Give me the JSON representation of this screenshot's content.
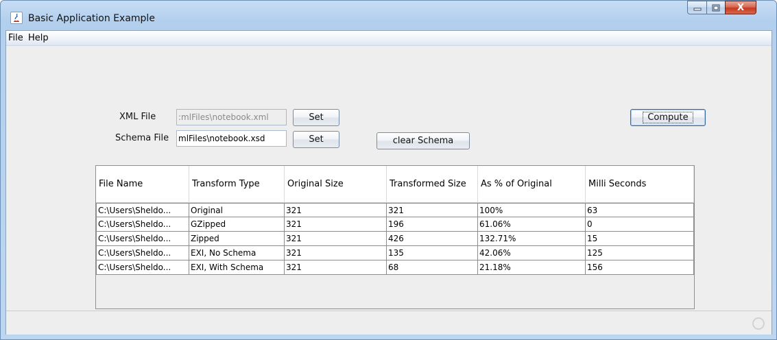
{
  "window": {
    "title": "Basic Application Example",
    "controls": {
      "minimize": "minimize",
      "maximize": "maximize",
      "close": "X"
    }
  },
  "menu": {
    "items": [
      "File",
      "Help"
    ]
  },
  "form": {
    "xml_label": "XML File",
    "xml_value": ":mlFiles\\notebook.xml",
    "schema_label": "Schema File",
    "schema_value": "mlFiles\\notebook.xsd",
    "set_label": "Set",
    "clear_schema_label": "clear Schema",
    "compute_label": "Compute"
  },
  "table": {
    "columns": [
      "File Name",
      "Transform Type",
      "Original Size",
      "Transformed Size",
      "As % of Original",
      "Milli Seconds"
    ],
    "rows": [
      [
        "C:\\Users\\Sheldo...",
        "Original",
        "321",
        "321",
        "100%",
        "63"
      ],
      [
        "C:\\Users\\Sheldo...",
        "GZipped",
        "321",
        "196",
        "61.06%",
        "0"
      ],
      [
        "C:\\Users\\Sheldo...",
        "Zipped",
        "321",
        "426",
        "132.71%",
        "15"
      ],
      [
        "C:\\Users\\Sheldo...",
        "EXI, No Schema",
        "321",
        "135",
        "42.06%",
        "125"
      ],
      [
        "C:\\Users\\Sheldo...",
        "EXI, With Schema",
        "321",
        "68",
        "21.18%",
        "156"
      ]
    ]
  },
  "icons": {
    "app": "java-icon",
    "busy": "busy-indicator-icon"
  }
}
